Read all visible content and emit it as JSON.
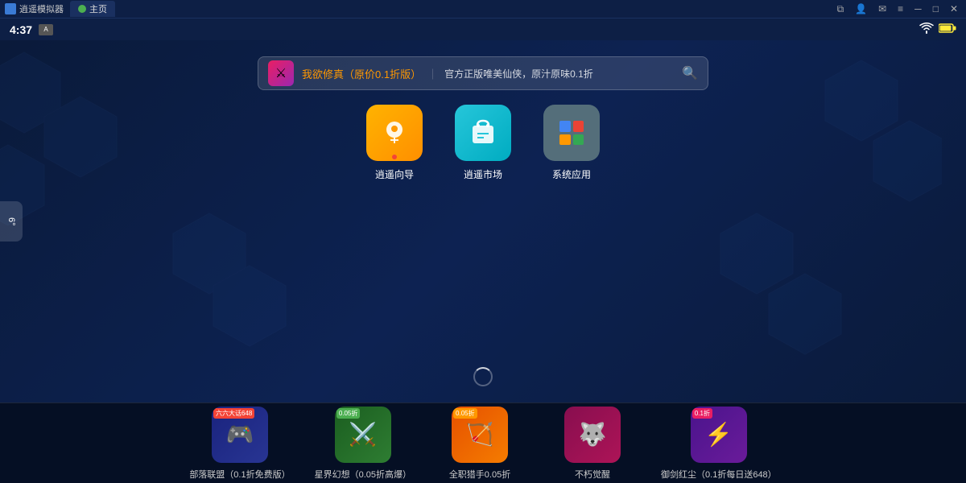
{
  "titlebar": {
    "app_name": "逍遥模拟器",
    "tab_label": "主页",
    "buttons": {
      "restore": "⧉",
      "account": "👤",
      "mail": "✉",
      "menu": "≡",
      "minimize": "─",
      "maximize": "□",
      "close": "✕"
    }
  },
  "statusbar": {
    "time": "4:37",
    "keyboard_label": "A",
    "wifi_icon": "▼",
    "battery_icon": "⚡"
  },
  "searchbar": {
    "game_title": "我欲修真（原价0.1折版）",
    "separator": "｜",
    "description": "官方正版唯美仙侠，原汁原味0.1折",
    "search_icon": "🔍"
  },
  "apps": [
    {
      "id": "guide",
      "label": "逍遥向导",
      "icon_type": "guide",
      "has_dot": true
    },
    {
      "id": "market",
      "label": "逍遥市场",
      "icon_type": "market",
      "has_dot": false
    },
    {
      "id": "system",
      "label": "系统应用",
      "icon_type": "system",
      "has_dot": false
    }
  ],
  "side_button": {
    "label": "6°"
  },
  "bottom_games": [
    {
      "id": "game1",
      "label": "部落联盟（0.1折免费版）",
      "badge": "六六大话648",
      "badge_type": "red",
      "icon_color": "game-icon-1",
      "icon_emoji": "🎮"
    },
    {
      "id": "game2",
      "label": "星界幻想（0.05折高爆）",
      "badge": "0.05折",
      "badge_type": "green",
      "icon_color": "game-icon-2",
      "icon_emoji": "⚔️"
    },
    {
      "id": "game3",
      "label": "全职猎手0.05折",
      "badge": "0.05折",
      "badge_type": "orange",
      "icon_color": "game-icon-3",
      "icon_emoji": "🏹"
    },
    {
      "id": "game4",
      "label": "不朽觉醒",
      "badge": "",
      "badge_type": "",
      "icon_color": "game-icon-4",
      "icon_emoji": "🐺"
    },
    {
      "id": "game5",
      "label": "御剑红尘（0.1折每日送648）",
      "badge": "0.1折",
      "badge_type": "red2",
      "icon_color": "game-icon-5",
      "icon_emoji": "⚡"
    }
  ]
}
